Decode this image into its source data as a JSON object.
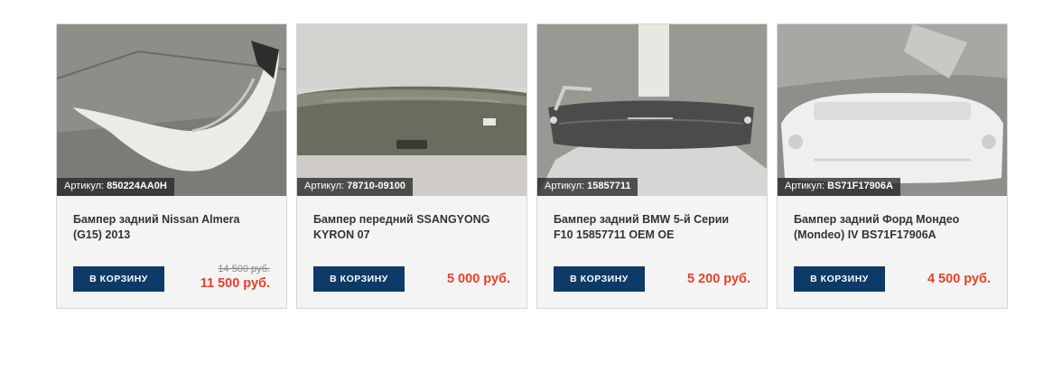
{
  "products": [
    {
      "sku_label": "Артикул:",
      "sku": "850224AA0H",
      "title": "Бампер задний Nissan Almera (G15) 2013",
      "button": "В КОРЗИНУ",
      "old_price": "14 500 руб.",
      "price": "11 500 руб.",
      "photo": "white rear bumper on concrete floor"
    },
    {
      "sku_label": "Артикул:",
      "sku": "78710-09100",
      "title": "Бампер передний SSANGYONG KYRON 07",
      "button": "В КОРЗИНУ",
      "price": "5 000 руб.",
      "photo": "olive grey front bumper"
    },
    {
      "sku_label": "Артикул:",
      "sku": "15857711",
      "title": "Бампер задний BMW 5-й Серии F10 15857711 OEM OE",
      "button": "В КОРЗИНУ",
      "price": "5 200 руб.",
      "photo": "dark grey rear bumper on plastic sheet"
    },
    {
      "sku_label": "Артикул:",
      "sku": "BS71F17906A",
      "title": "Бампер задний Форд Мондео (Mondeo) IV BS71F17906A",
      "button": "В КОРЗИНУ",
      "price": "4 500 руб.",
      "photo": "white rear bumper on cloth"
    }
  ],
  "colors": {
    "button_bg": "#0d3a66",
    "price": "#e8402c",
    "card_bg": "#f4f4f4"
  }
}
